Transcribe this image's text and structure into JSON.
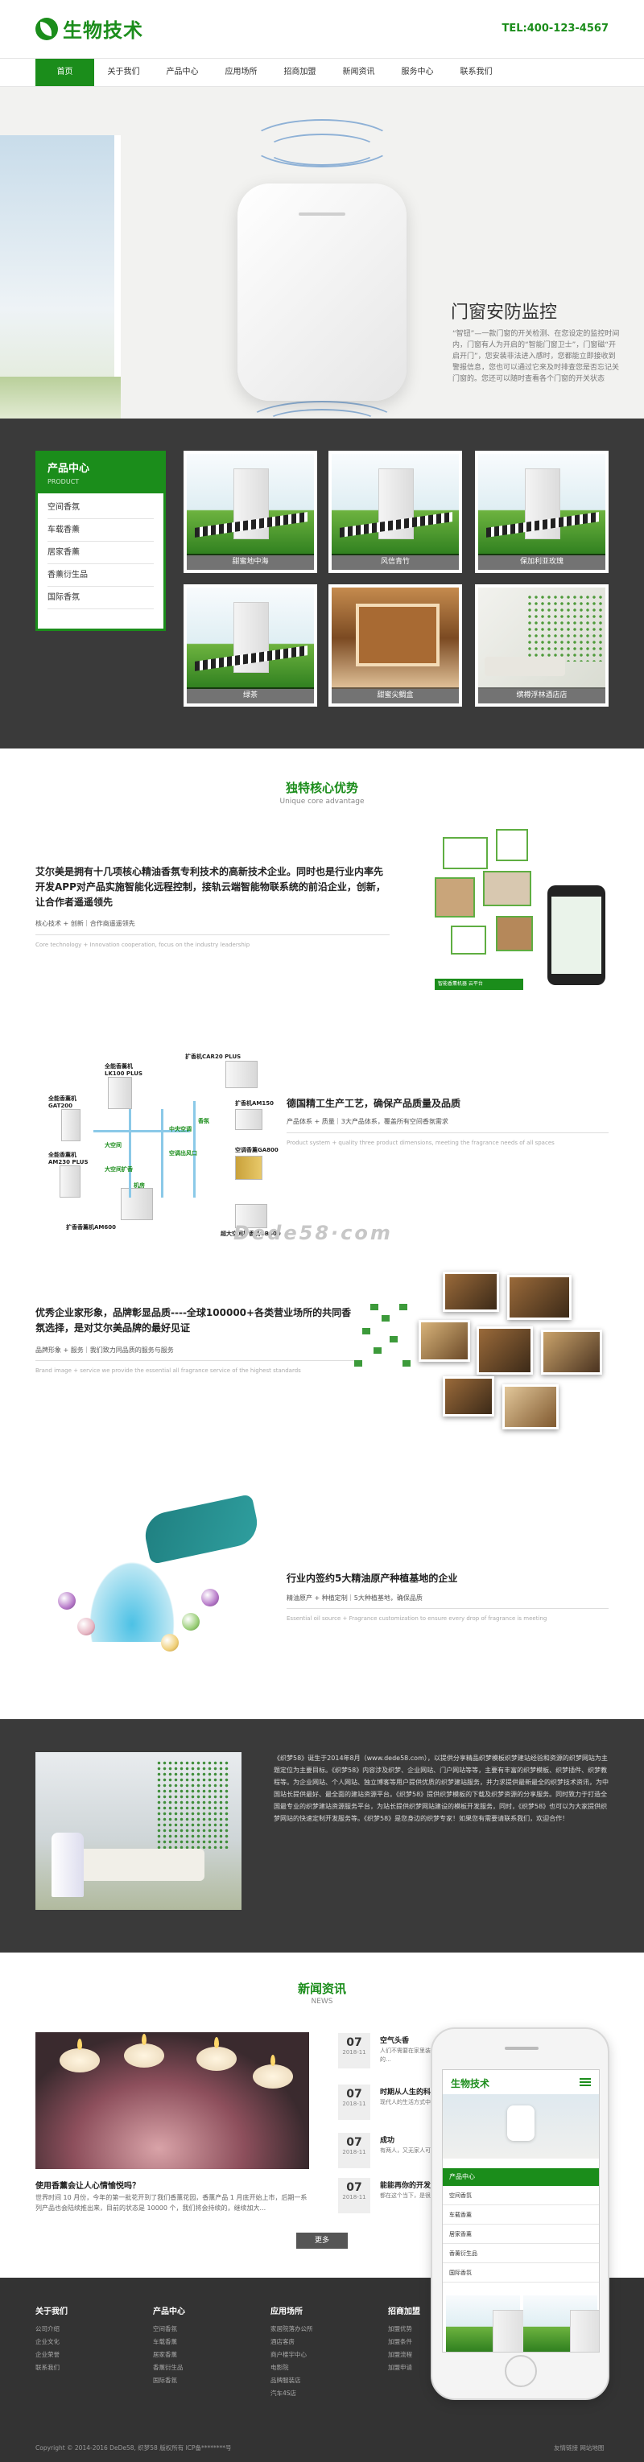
{
  "header": {
    "logo_text": "生物技术",
    "tel": "TEL:400-123-4567"
  },
  "nav": [
    "首页",
    "关于我们",
    "产品中心",
    "应用场所",
    "招商加盟",
    "新闻资讯",
    "服务中心",
    "联系我们"
  ],
  "banner": {
    "title": "门窗安防监控",
    "desc": "“智钮”—一款门窗的开关检测、在您设定的监控时间内，门窗有人为开启的“智能门窗卫士”，门窗磁“开启开门”，您安装非法进入感时，您都能立即接收到警报信息，您也可以通过它来及时排查您是否忘记关门窗的。您还可以随时查看各个门窗的开关状态"
  },
  "products": {
    "menu_title": "产品中心",
    "menu_sub": "PRODUCT",
    "menu_items": [
      "空间香氛",
      "车载香薰",
      "居家香薰",
      "香薰衍生品",
      "国际香氛"
    ],
    "tiles": [
      "甜蜜地中海",
      "风信青竹",
      "保加利亚玫瑰",
      "绿茶",
      "甜蜜尖鲷盒",
      "缤樽浮林酒店店"
    ]
  },
  "advantages": {
    "title": "独特核心优势",
    "subtitle": "Unique core advantage",
    "watermark": "Dede58·com",
    "items": [
      {
        "heading": "艾尔美是拥有十几项核心精油香氛专利技术的高新技术企业。同时也是行业内率先开发APP对产品实施智能化远程控制，接轨云端智能物联系统的前沿企业，创新，让合作者遥遥领先",
        "meta": "核心技术 + 创新｜合作商遥遥领先",
        "en": "Core technology + Innovation cooperation, focus on the industry leadership",
        "badge": "智能香薰机器   云平台"
      },
      {
        "heading": "德国精工生产工艺，确保产品质量及品质",
        "meta": "产品体系 + 质量｜3大产品体系，覆盖所有空间香氛需求",
        "en": "Product system + quality three product dimensions, meeting the fragrance needs of all spaces",
        "labels": [
          "全能香薰机 LK100 PLUS",
          "扩香机CAR20 PLUS",
          "全能香薰机 GAT200",
          "扩香机AM150",
          "全能香薰机 AM230 PLUS",
          "空调香薰GA800",
          "扩香香薰机AM600",
          "超大空间扩香机GB600",
          "中央空调",
          "大空间",
          "机房",
          "空调出风口",
          "香氛",
          "大空间扩香"
        ]
      },
      {
        "heading": "优秀企业家形象，品牌彰显品质----全球100000+各类营业场所的共同香氛选择，是对艾尔美品牌的最好见证",
        "meta": "品牌形象 + 服务｜我们致力同品质的服务与服务",
        "en": "Brand image + service we provide the essential all fragrance service of the highest standards"
      },
      {
        "heading": "行业内签约5大精油原产种植基地的企业",
        "meta": "精油原产 + 种植定制｜5大种植基地，确保品质",
        "en": "Essential oil source + Fragrance customization to ensure every drop of fragrance is meeting"
      }
    ]
  },
  "about": {
    "text": "《织梦58》诞生于2014年8月（www.dede58.com），以提供分享精品织梦模板织梦建站经验和资源的织梦网站为主题定位为主要目标。《织梦58》内容涉及织梦、企业网站、门户网站等等，主要有丰富的织梦模板、织梦插件、织梦教程等。为企业网站、个人网站、独立博客等用户提供优质的织梦建站服务，并力求提供最新最全的织梦技术资讯，为中国站长提供最好、最全面的建站资源平台。《织梦58》提供织梦模板的下载及织梦资源的分享服务。同时致力于打造全国最专业的织梦建站资源服务平台，为站长提供织梦网站建设的模板开发服务，同时，《织梦58》也可以为大家提供织梦网站的快速定制开发服务等。《织梦58》是您身边的织梦专家！如果您有需要请联系我们，欢迎合作！"
  },
  "news": {
    "title": "新闻资讯",
    "subtitle": "NEWS",
    "feature": {
      "title": "使用香薰会让人心情愉悦吗？",
      "desc": "世界时间 10 月份，今年的第一批花开到了我们香薰花园，香薰产品 1 月底开始上市，后期一系列产品也会陆续推出来，目前的状态是 10000 个，我们将会持续的，继续加大..."
    },
    "items": [
      {
        "day": "07",
        "ym": "2018-11",
        "title": "空气头香",
        "text": "人们不需要在家里装修很多，就是需要一个干净，舒适的家庭，空气也是一样的..."
      },
      {
        "day": "07",
        "ym": "2018-11",
        "title": "时期从人生的科学生活",
        "text": "现代人的生活方式中，不可避免的会接触到很多化学物质..."
      },
      {
        "day": "07",
        "ym": "2018-11",
        "title": "成功",
        "text": "有两人，又无家人可以出去进行家务整理，我们也可以..."
      },
      {
        "day": "07",
        "ym": "2018-11",
        "title": "能能再你的开发文生",
        "text": "都在这个当下，是很多人都能理解的，自己平时也在坚持..."
      }
    ],
    "more": "更多"
  },
  "phone": {
    "logo": "生物技术",
    "menu_title": "产品中心",
    "menu_items": [
      "空间香氛",
      "车载香薰",
      "居家香薰",
      "香薰衍生品",
      "国际香氛"
    ]
  },
  "footer": {
    "columns": [
      {
        "title": "关于我们",
        "links": [
          "公司介绍",
          "企业文化",
          "企业荣誉",
          "联系我们"
        ]
      },
      {
        "title": "产品中心",
        "links": [
          "空间香氛",
          "车载香薰",
          "居家香薰",
          "香薰衍生品",
          "国际香氛"
        ]
      },
      {
        "title": "应用场所",
        "links": [
          "家居院落办公所",
          "酒店客房",
          "商户楼宇中心",
          "电影院",
          "品牌服装店",
          "汽车4S店"
        ]
      },
      {
        "title": "招商加盟",
        "links": [
          "加盟优势",
          "加盟条件",
          "加盟流程",
          "加盟申请"
        ]
      }
    ],
    "copyright": "Copyright © 2014-2016 DeDe58, 织梦58 版权所有  ICP备********号",
    "links": "友情链接  网站地图"
  }
}
